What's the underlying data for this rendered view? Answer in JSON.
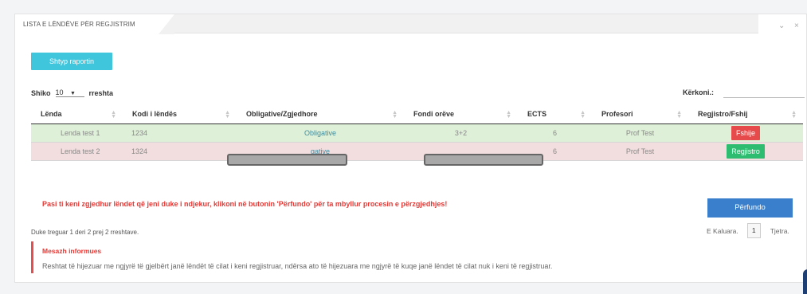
{
  "tab": {
    "title": "LISTA E LËNDËVE PËR REGJISTRIM"
  },
  "window_controls": {
    "collapse": "⌄",
    "close": "×"
  },
  "toolbar": {
    "print_label": "Shtyp raportin"
  },
  "length": {
    "prefix": "Shiko",
    "value": "10",
    "arrow": "▼",
    "suffix": "rreshta"
  },
  "search": {
    "label": "Kërkoni.:",
    "value": ""
  },
  "table": {
    "headers": [
      "Lënda",
      "Kodi i lëndës",
      "Obligative/Zgjedhore",
      "Fondi orëve",
      "ECTS",
      "Profesori",
      "Regjistro/Fshij"
    ],
    "rows": [
      {
        "name": "Lenda test 1",
        "code": "1234",
        "type": "Obligative",
        "hours": "3+2",
        "ects": "6",
        "professor": "Prof Test",
        "action": "Fshije",
        "status": "registered"
      },
      {
        "name": "Lenda test 2",
        "code": "1324",
        "type": "gative",
        "hours": "",
        "ects": "6",
        "professor": "Prof Test",
        "action": "Regjistro",
        "status": "not-registered"
      }
    ]
  },
  "notice": {
    "text": "Pasi ti keni zgjedhur lëndet që jeni duke i ndjekur, klikoni në butonin 'Përfundo' për ta mbyllur procesin e përzgjedhjes!"
  },
  "finish": {
    "label": "Përfundo"
  },
  "pagination": {
    "summary": "Duke treguar 1 deri 2 prej 2 rreshtave.",
    "prev": "E Kaluara.",
    "page": "1",
    "next": "Tjetra."
  },
  "info": {
    "title": "Mesazh informues",
    "body": "Reshtat të hijezuar me ngjyrë të gjelbërt janë lëndët të cilat i keni regjistruar, ndërsa ato të hijezuara me ngjyrë të kuqe janë lëndet të cilat nuk i keni të regjistruar."
  },
  "colors": {
    "print_button": "#3fc5dc",
    "registered_row": "#dff0d8",
    "unregistered_row": "#f2dede",
    "delete_button": "#e64a4a",
    "register_button": "#2ebd70",
    "finish_button": "#3a7fcb",
    "warning_text": "#e53935"
  }
}
